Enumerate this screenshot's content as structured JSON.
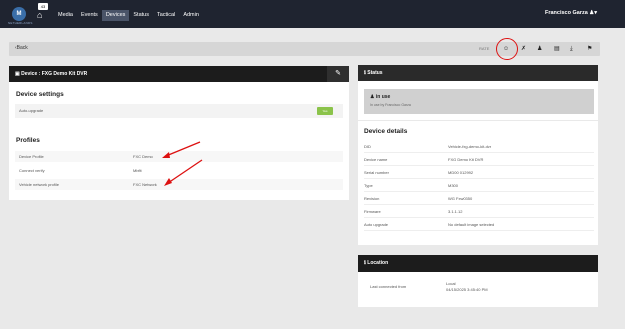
{
  "nav": {
    "badge": "43",
    "logo_text": "NETHERLANDS",
    "items": [
      "Media",
      "Events",
      "Devices",
      "Status",
      "Tactical",
      "Admin"
    ],
    "active": "Devices",
    "user": "Francisco Garza"
  },
  "toolbar": {
    "back": "Back",
    "rate": "RATE"
  },
  "device": {
    "title": "Device : FXG Demo Kit DVR",
    "settings_title": "Device settings",
    "auto_upgrade_label": "Auto-upgrade",
    "toggle_label": "Yes",
    "profiles_title": "Profiles",
    "profiles": [
      {
        "label": "Device Profile",
        "value": "FXC Demo"
      },
      {
        "label": "Connect verify",
        "value": "Mbfit"
      },
      {
        "label": "Vehicle network profile",
        "value": "FXC Network"
      }
    ]
  },
  "status": {
    "title": "Status",
    "state": "in use",
    "sub": "In use by Francisco Garza"
  },
  "details": {
    "title": "Device details",
    "rows": [
      {
        "label": "DID",
        "value": "Vehicle-fxg-demo-kit-dvr"
      },
      {
        "label": "Device name",
        "value": "FXG Demo Kit DVR"
      },
      {
        "label": "Serial number",
        "value": "MD00 012992"
      },
      {
        "label": "Type",
        "value": "M300"
      },
      {
        "label": "Revision",
        "value": "WG Fxw0350"
      },
      {
        "label": "Firmware",
        "value": "3.1.1.12"
      },
      {
        "label": "Auto upgrade",
        "value": "No default image selected"
      }
    ]
  },
  "location": {
    "title": "Location",
    "last_connected_label": "Last connected from",
    "last_connected_value": "Local",
    "last_connected_date": "04/15/2025 3:45:40 PM"
  },
  "colors": {
    "topbar": "#1f2430",
    "accent_red": "#d11",
    "toggle": "#8bc34a"
  }
}
